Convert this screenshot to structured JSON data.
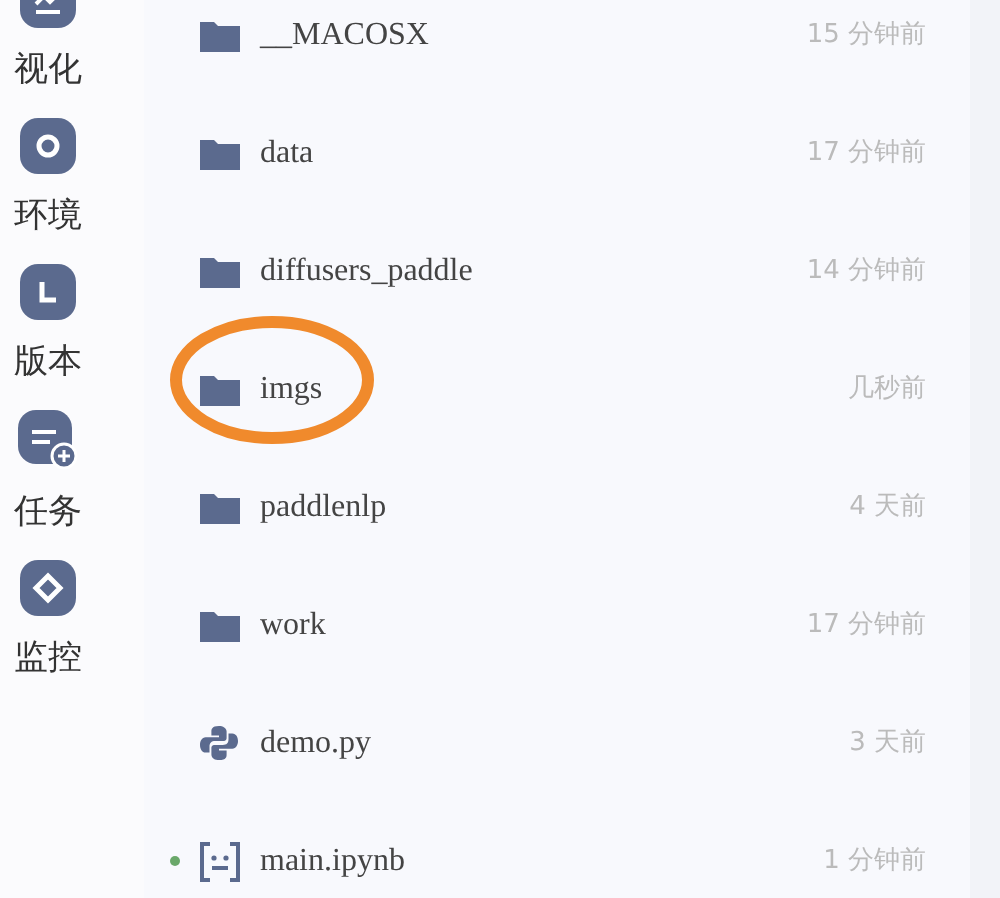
{
  "sidebar": {
    "items": [
      {
        "kind": "chart",
        "label": "视化"
      },
      {
        "kind": "circle",
        "label": "环境"
      },
      {
        "kind": "version",
        "label": "版本"
      },
      {
        "kind": "task",
        "label": "任务"
      },
      {
        "kind": "diamond",
        "label": "监控"
      }
    ]
  },
  "files": [
    {
      "kind": "folder",
      "name": "__MACOSX",
      "modified": "15 分钟前",
      "running": false,
      "highlighted": false
    },
    {
      "kind": "folder",
      "name": "data",
      "modified": "17 分钟前",
      "running": false,
      "highlighted": false
    },
    {
      "kind": "folder",
      "name": "diffusers_paddle",
      "modified": "14 分钟前",
      "running": false,
      "highlighted": false
    },
    {
      "kind": "folder",
      "name": "imgs",
      "modified": "几秒前",
      "running": false,
      "highlighted": true
    },
    {
      "kind": "folder",
      "name": "paddlenlp",
      "modified": "4 天前",
      "running": false,
      "highlighted": false
    },
    {
      "kind": "folder",
      "name": "work",
      "modified": "17 分钟前",
      "running": false,
      "highlighted": false
    },
    {
      "kind": "python",
      "name": "demo.py",
      "modified": "3 天前",
      "running": false,
      "highlighted": false
    },
    {
      "kind": "notebook",
      "name": "main.ipynb",
      "modified": "1 分钟前",
      "running": true,
      "highlighted": false
    }
  ]
}
